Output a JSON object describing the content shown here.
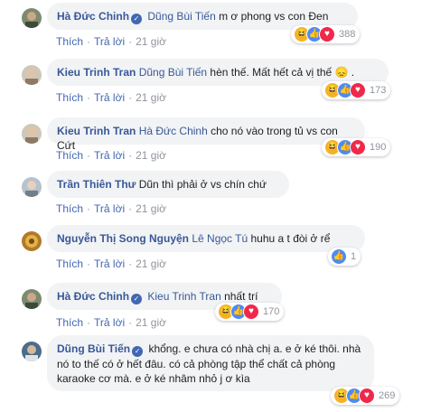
{
  "actions": {
    "like": "Thích",
    "reply": "Trả lời",
    "sep": "·",
    "time": "21 giờ"
  },
  "icons": {
    "haha": "haha-icon",
    "like": "like-icon",
    "love": "love-icon",
    "verified": "verified-icon"
  },
  "comments": [
    {
      "author": "Hà Đức Chinh",
      "verified": true,
      "tag": "Dũng Bùi Tiến",
      "text": " m ơ phong vs con Đen",
      "reactions": [
        "haha",
        "like",
        "love"
      ],
      "count": "388"
    },
    {
      "author": "Kieu Trinh Tran",
      "verified": false,
      "tag": "Dũng Bùi Tiến",
      "text": " hèn thế. Mất hết cả vị thế 😞 .",
      "reactions": [
        "haha",
        "like",
        "love"
      ],
      "count": "173"
    },
    {
      "author": "Kieu Trinh Tran",
      "verified": false,
      "tag": "Hà Đức Chinh",
      "text": " cho nó vào trong tủ vs con Cứt",
      "reactions": [
        "haha",
        "like",
        "love"
      ],
      "count": "190"
    },
    {
      "author": "Trần Thiên Thư",
      "verified": false,
      "tag": "",
      "text": "Dũn thì phải ở vs chín chứ",
      "reactions": [],
      "count": ""
    },
    {
      "author": "Nguyễn Thị Song Nguyện",
      "verified": false,
      "tag": "Lê Ngọc Tú",
      "text": " huhu a t đòi ở rể",
      "reactions": [
        "like"
      ],
      "count": "1"
    },
    {
      "author": "Hà Đức Chinh",
      "verified": true,
      "tag": "Kieu Trinh Tran",
      "text": " nhất trí",
      "reactions": [
        "haha",
        "like",
        "love"
      ],
      "count": "170"
    },
    {
      "author": "Dũng Bùi Tiến",
      "verified": true,
      "tag": "",
      "text": "khổng. e chưa có nhà chị a. e ở ké thôi. nhà nó to thế có ở hết đâu. có cả phòng tập thể chất cả phòng karaoke cơ mà. e ở ké nhâm nhỏ j ơ kìa",
      "reactions": [
        "haha",
        "like",
        "love"
      ],
      "count": "269"
    }
  ]
}
